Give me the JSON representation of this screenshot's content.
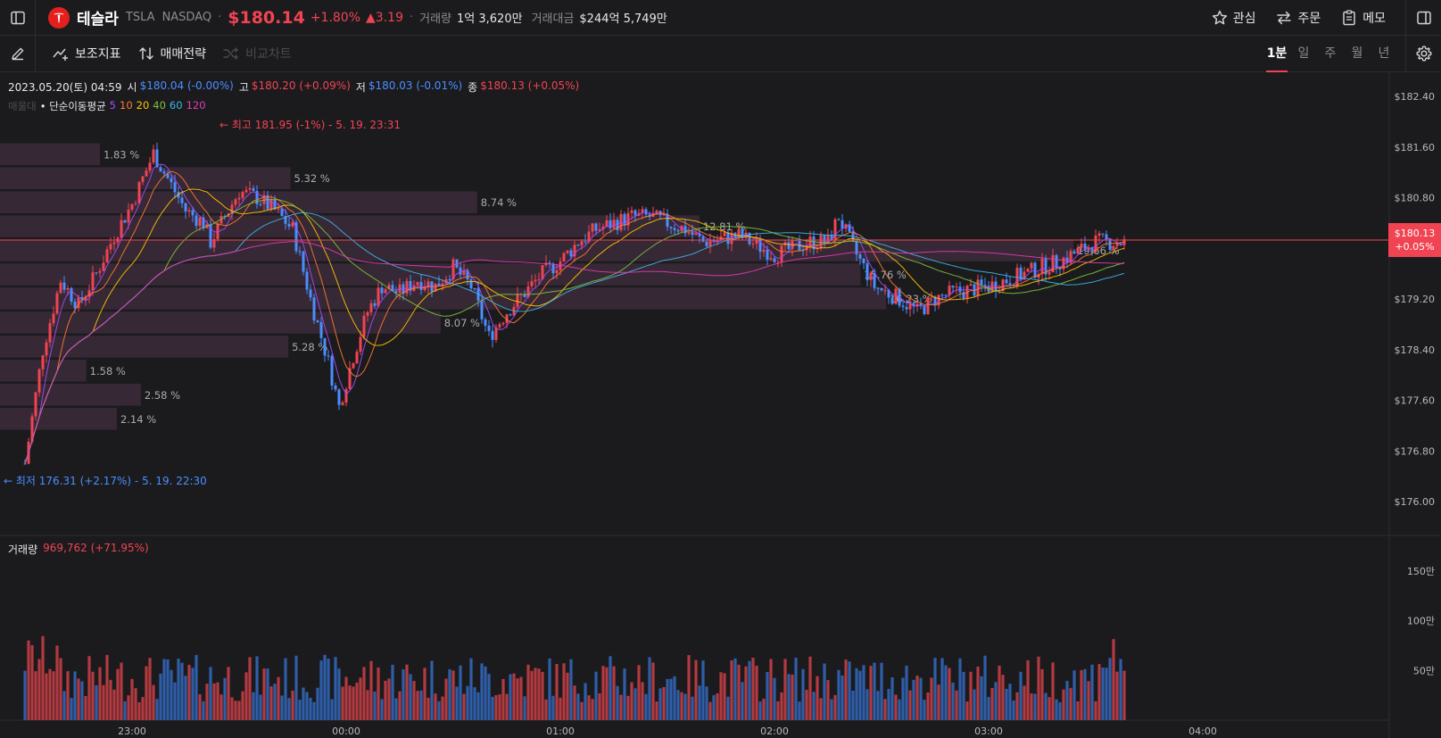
{
  "header": {
    "stock_name": "테슬라",
    "ticker": "TSLA",
    "exchange": "NASDAQ",
    "price": "$180.14",
    "change_pct": "+1.80%",
    "change_abs": "▲3.19",
    "volume_label": "거래량",
    "volume_value": "1억 3,620만",
    "amount_label": "거래대금",
    "amount_value": "$244억 5,749만",
    "actions": [
      "관심",
      "주문",
      "메모"
    ]
  },
  "toolbar": {
    "indicators_label": "보조지표",
    "strategy_label": "매매전략",
    "compare_label": "비교차트",
    "periods": [
      "1분",
      "일",
      "주",
      "월",
      "년"
    ],
    "active_period": "1분"
  },
  "ohlc": {
    "datetime": "2023.05.20(토) 04:59",
    "open_label": "시",
    "open": "$180.04 (-0.00%)",
    "high_label": "고",
    "high": "$180.20 (+0.09%)",
    "low_label": "저",
    "low": "$180.03 (-0.01%)",
    "close_label": "종",
    "close": "$180.13 (+0.05%)"
  },
  "ma": {
    "disabled_label": "매물대",
    "label": "• 단순이동평균",
    "periods": [
      "5",
      "10",
      "20",
      "40",
      "60",
      "120"
    ],
    "colors": [
      "#a64bff",
      "#ff7a30",
      "#ffc400",
      "#7cc43a",
      "#3fb5e8",
      "#e33bb1"
    ]
  },
  "annotations": {
    "high": "← 최고 181.95 (-1%) - 5. 19. 23:31",
    "low": "← 최저 176.31 (+2.17%) - 5. 19. 22:30"
  },
  "last_price_tag": {
    "price": "$180.13",
    "change": "+0.05%"
  },
  "volume_panel": {
    "label": "거래량",
    "value": "969,762 (+71.95%)"
  },
  "colors": {
    "up": "#f04452",
    "down": "#4a8eff",
    "background": "#1b1b1e"
  },
  "chart_data": {
    "type": "candlestick",
    "price_axis": [
      "$182.40",
      "$181.60",
      "$180.80",
      "$180.00",
      "$179.20",
      "$178.40",
      "$177.60",
      "$176.80",
      "$176.00"
    ],
    "ylim": [
      175.75,
      182.6
    ],
    "time_axis": [
      "23:00",
      "00:00",
      "01:00",
      "02:00",
      "03:00",
      "04:00"
    ],
    "volume_axis": [
      "150만",
      "100만",
      "50만"
    ],
    "volume_profile": [
      {
        "price": 181.48,
        "pct": "1.83 %",
        "share": 1.83
      },
      {
        "price": 181.1,
        "pct": "5.32 %",
        "share": 5.32
      },
      {
        "price": 180.72,
        "pct": "8.74 %",
        "share": 8.74
      },
      {
        "price": 180.34,
        "pct": "12.81 %",
        "share": 12.81
      },
      {
        "price": 179.96,
        "pct": "19.66 %",
        "share": 19.66
      },
      {
        "price": 179.58,
        "pct": "15.76 %",
        "share": 15.76
      },
      {
        "price": 179.2,
        "pct": "16.23 %",
        "share": 16.23
      },
      {
        "price": 178.82,
        "pct": "8.07 %",
        "share": 8.07
      },
      {
        "price": 178.44,
        "pct": "5.28 %",
        "share": 5.28
      },
      {
        "price": 178.06,
        "pct": "1.58 %",
        "share": 1.58
      },
      {
        "price": 177.68,
        "pct": "2.58 %",
        "share": 2.58
      },
      {
        "price": 177.3,
        "pct": "2.14 %",
        "share": 2.14
      }
    ],
    "price_path_min": [
      [
        0,
        176.6
      ],
      [
        5,
        178.4
      ],
      [
        10,
        179.5
      ],
      [
        15,
        179.1
      ],
      [
        20,
        179.6
      ],
      [
        25,
        180.2
      ],
      [
        30,
        180.7
      ],
      [
        33,
        181.1
      ],
      [
        36,
        181.5
      ],
      [
        40,
        181.1
      ],
      [
        45,
        180.6
      ],
      [
        50,
        180.4
      ],
      [
        52,
        180.1
      ],
      [
        55,
        180.4
      ],
      [
        60,
        180.9
      ],
      [
        65,
        180.8
      ],
      [
        70,
        180.6
      ],
      [
        75,
        180.3
      ],
      [
        80,
        179.2
      ],
      [
        85,
        178.2
      ],
      [
        88,
        177.5
      ],
      [
        92,
        178.3
      ],
      [
        96,
        179.0
      ],
      [
        100,
        179.4
      ],
      [
        105,
        179.3
      ],
      [
        110,
        179.5
      ],
      [
        115,
        179.4
      ],
      [
        120,
        179.7
      ],
      [
        125,
        179.4
      ],
      [
        130,
        178.6
      ],
      [
        135,
        179.0
      ],
      [
        140,
        179.3
      ],
      [
        145,
        179.6
      ],
      [
        150,
        179.8
      ],
      [
        155,
        180.1
      ],
      [
        160,
        180.3
      ],
      [
        165,
        180.4
      ],
      [
        170,
        180.5
      ],
      [
        175,
        180.5
      ],
      [
        180,
        180.4
      ],
      [
        185,
        180.3
      ],
      [
        190,
        180.1
      ],
      [
        200,
        180.2
      ],
      [
        210,
        179.9
      ],
      [
        220,
        180.1
      ],
      [
        225,
        180.1
      ],
      [
        228,
        180.5
      ],
      [
        232,
        180.0
      ],
      [
        238,
        179.4
      ],
      [
        245,
        179.2
      ],
      [
        250,
        179.0
      ],
      [
        255,
        179.2
      ],
      [
        260,
        179.3
      ],
      [
        270,
        179.4
      ],
      [
        280,
        179.6
      ],
      [
        290,
        179.8
      ],
      [
        300,
        180.1
      ],
      [
        308,
        180.1
      ]
    ],
    "last_close": 180.13
  }
}
